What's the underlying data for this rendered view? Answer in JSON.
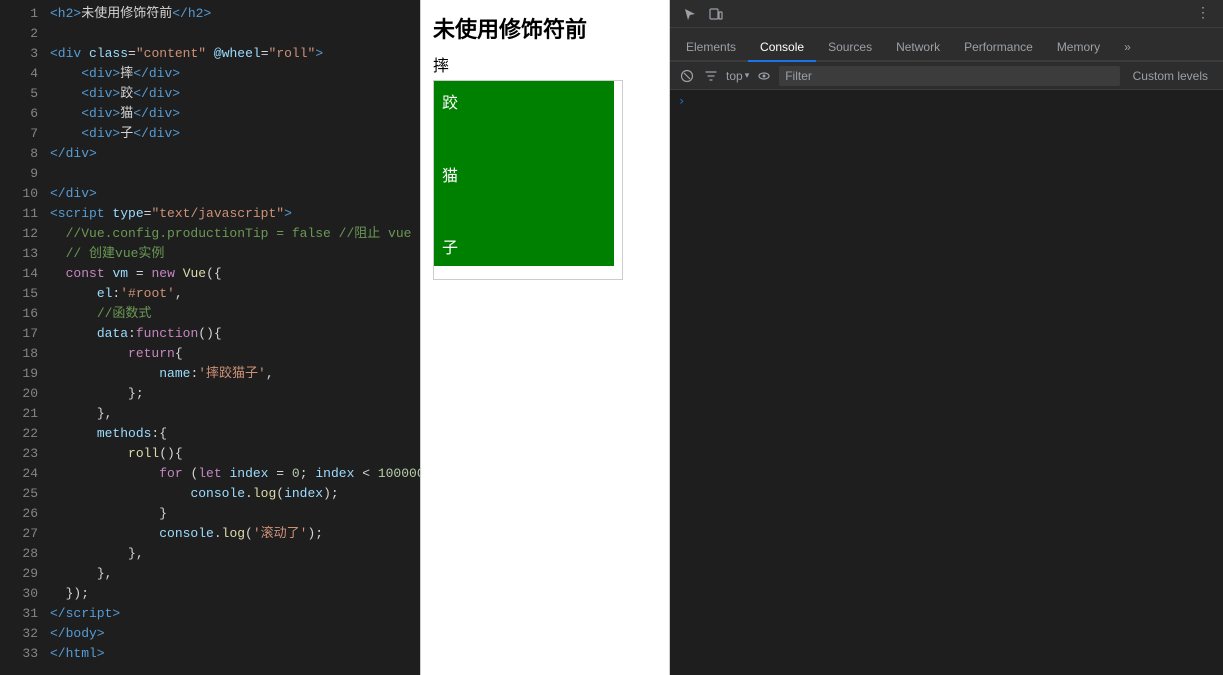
{
  "code_panel": {
    "lines": [
      {
        "ln": 1,
        "html": "<span class='c-tag'>&lt;h2&gt;</span><span class='c-text'>未使用修饰符前</span><span class='c-tag'>&lt;/h2&gt;</span>"
      },
      {
        "ln": 2,
        "html": ""
      },
      {
        "ln": 3,
        "html": "<span class='c-tag'>&lt;div</span> <span class='c-attr'>class</span><span class='c-eq'>=</span><span class='c-val'>\"content\"</span> <span class='c-attr'>@wheel</span><span class='c-eq'>=</span><span class='c-val'>\"roll\"</span><span class='c-tag'>&gt;</span>"
      },
      {
        "ln": 4,
        "html": "    <span class='c-tag'>&lt;div&gt;</span><span class='c-text'>摔</span><span class='c-tag'>&lt;/div&gt;</span>"
      },
      {
        "ln": 5,
        "html": "    <span class='c-tag'>&lt;div&gt;</span><span class='c-text'>跤</span><span class='c-tag'>&lt;/div&gt;</span>"
      },
      {
        "ln": 6,
        "html": "    <span class='c-tag'>&lt;div&gt;</span><span class='c-text'>猫</span><span class='c-tag'>&lt;/div&gt;</span>"
      },
      {
        "ln": 7,
        "html": "    <span class='c-tag'>&lt;div&gt;</span><span class='c-text'>子</span><span class='c-tag'>&lt;/div&gt;</span>"
      },
      {
        "ln": 8,
        "html": "<span class='c-tag'>&lt;/div&gt;</span>"
      },
      {
        "ln": 9,
        "html": ""
      },
      {
        "ln": 10,
        "html": "<span class='c-tag'>&lt;/div&gt;</span>"
      },
      {
        "ln": 11,
        "html": "<span class='c-tag'>&lt;script</span> <span class='c-attr'>type</span><span class='c-eq'>=</span><span class='c-val'>\"text/javascript\"</span><span class='c-tag'>&gt;</span>"
      },
      {
        "ln": 12,
        "html": "  <span class='c-comment'>//Vue.config.productionTip = false //阻止 vue 在</span>"
      },
      {
        "ln": 13,
        "html": "  <span class='c-comment'>// 创建vue实例</span>"
      },
      {
        "ln": 14,
        "html": "  <span class='c-keyword'>const</span> <span class='c-var'>vm</span> <span class='c-punct'>=</span> <span class='c-keyword'>new</span> <span class='c-func'>Vue</span><span class='c-punct'>({</span>"
      },
      {
        "ln": 15,
        "html": "      <span class='c-attr'>el</span><span class='c-punct'>:</span><span class='c-str'>'#root'</span><span class='c-punct'>,</span>"
      },
      {
        "ln": 16,
        "html": "      <span class='c-comment'>//函数式</span>"
      },
      {
        "ln": 17,
        "html": "      <span class='c-attr'>data</span><span class='c-punct'>:</span><span class='c-keyword'>function</span><span class='c-punct'>(){</span>"
      },
      {
        "ln": 18,
        "html": "          <span class='c-keyword'>return</span><span class='c-punct'>{</span>"
      },
      {
        "ln": 19,
        "html": "              <span class='c-attr'>name</span><span class='c-punct'>:</span><span class='c-str'>'摔跤猫子'</span><span class='c-punct'>,</span>"
      },
      {
        "ln": 20,
        "html": "          <span class='c-punct'>};</span>"
      },
      {
        "ln": 21,
        "html": "      <span class='c-punct'>},</span>"
      },
      {
        "ln": 22,
        "html": "      <span class='c-attr'>methods</span><span class='c-punct'>:{</span>"
      },
      {
        "ln": 23,
        "html": "          <span class='c-func'>roll</span><span class='c-punct'>(){</span>"
      },
      {
        "ln": 24,
        "html": "              <span class='c-keyword'>for</span> <span class='c-punct'>(</span><span class='c-keyword'>let</span> <span class='c-var'>index</span> <span class='c-punct'>=</span> <span class='c-num'>0</span><span class='c-punct'>;</span> <span class='c-var'>index</span> <span class='c-punct'>&lt;</span> <span class='c-num'>100000</span><span class='c-punct'>;</span>"
      },
      {
        "ln": 25,
        "html": "                  <span class='c-var'>console</span><span class='c-punct'>.</span><span class='c-func'>log</span><span class='c-punct'>(</span><span class='c-var'>index</span><span class='c-punct'>);</span>"
      },
      {
        "ln": 26,
        "html": "              <span class='c-punct'>}</span>"
      },
      {
        "ln": 27,
        "html": "              <span class='c-var'>console</span><span class='c-punct'>.</span><span class='c-func'>log</span><span class='c-punct'>(</span><span class='c-str'>'滚动了'</span><span class='c-punct'>);</span>"
      },
      {
        "ln": 28,
        "html": "          <span class='c-punct'>},</span>"
      },
      {
        "ln": 29,
        "html": "      <span class='c-punct'>},</span>"
      },
      {
        "ln": 30,
        "html": "  <span class='c-punct'>});</span>"
      },
      {
        "ln": 31,
        "html": "<span class='c-tag'>&lt;/script&gt;</span>"
      },
      {
        "ln": 32,
        "html": "<span class='c-tag'>&lt;/body&gt;</span>"
      },
      {
        "ln": 33,
        "html": "<span class='c-tag'>&lt;/html&gt;</span>"
      }
    ]
  },
  "preview": {
    "title": "未使用修饰符前",
    "items_above": [
      "摔"
    ],
    "items_in_box": [
      "跤"
    ],
    "box_color": "#008000"
  },
  "devtools": {
    "top_icons": [
      "cursor-icon",
      "device-icon",
      "more-icon"
    ],
    "tabs": [
      {
        "label": "Elements",
        "active": false
      },
      {
        "label": "Console",
        "active": true
      },
      {
        "label": "Sources",
        "active": false
      },
      {
        "label": "Network",
        "active": false
      },
      {
        "label": "Performance",
        "active": false
      },
      {
        "label": "Memory",
        "active": false
      },
      {
        "label": "»",
        "active": false
      }
    ],
    "toolbar": {
      "context": "top",
      "filter_placeholder": "Filter",
      "custom_levels": "Custom levels"
    },
    "console_output": []
  }
}
